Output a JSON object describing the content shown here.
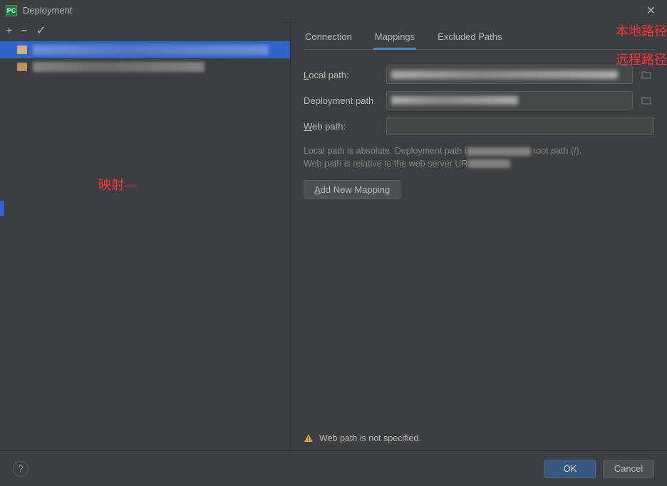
{
  "window": {
    "title": "Deployment",
    "app_icon_text": "PC"
  },
  "tabs": {
    "connection": "Connection",
    "mappings": "Mappings",
    "excluded_paths": "Excluded Paths"
  },
  "fields": {
    "local_path_label_pre": "L",
    "local_path_label_post": "ocal path:",
    "deployment_path_label": "Deployment path",
    "web_path_label_pre": "W",
    "web_path_label_post": "eb path:"
  },
  "help_text": {
    "line1_pre": "Local path is absolute. Deployment path i",
    "line1_post": " root path (/).",
    "line2": "Web path is relative to the web server UR"
  },
  "buttons": {
    "add_mapping_pre": "A",
    "add_mapping_post": "dd New Mapping",
    "ok": "OK",
    "cancel": "Cancel",
    "help": "?"
  },
  "warning": {
    "text": "Web path is not specified."
  },
  "annotations": {
    "mapping": "映射—",
    "local_path": "本地路径",
    "remote_path": "远程路径"
  }
}
